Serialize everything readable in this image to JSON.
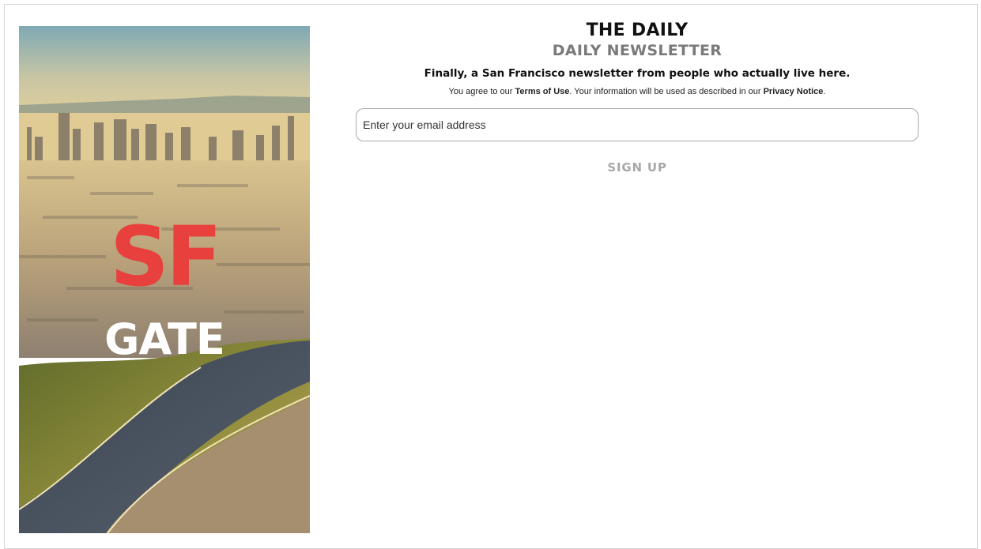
{
  "hero": {
    "logo_top": "SF",
    "logo_bottom": "GATE",
    "accent_color": "#e8403c"
  },
  "newsletter": {
    "title": "THE DAILY",
    "subtitle": "DAILY NEWSLETTER",
    "tagline": "Finally, a San Francisco newsletter from people who actually live here.",
    "legal_prefix": "You agree to our ",
    "terms_link": "Terms of Use",
    "legal_middle": ". Your information will be used as described in our ",
    "privacy_link": "Privacy Notice",
    "legal_suffix": ".",
    "email_placeholder": "Enter your email address",
    "signup_label": "SIGN UP"
  }
}
